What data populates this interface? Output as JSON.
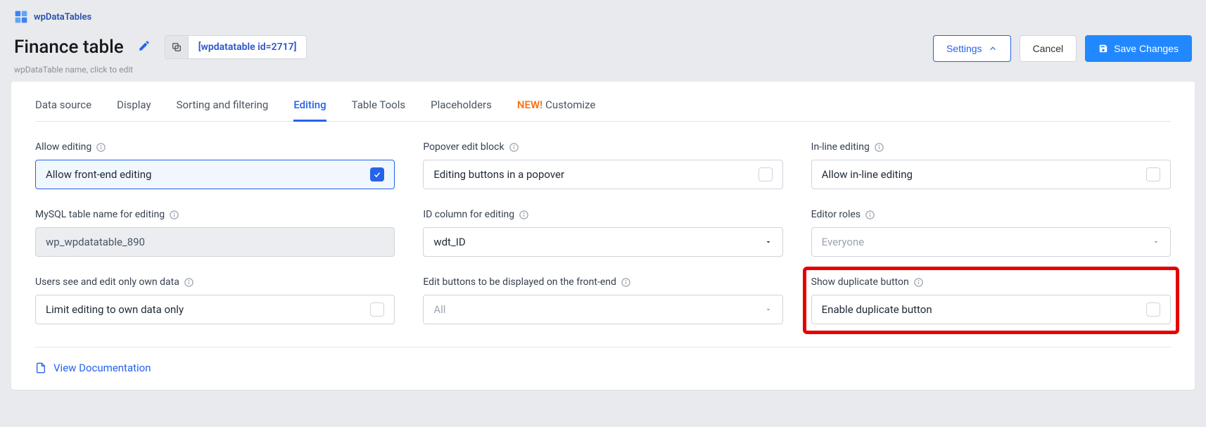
{
  "brand": {
    "name": "wpDataTables"
  },
  "header": {
    "title": "Finance table",
    "subtitle": "wpDataTable name, click to edit",
    "shortcode": "[wpdatatable id=2717]"
  },
  "actions": {
    "settings": "Settings",
    "cancel": "Cancel",
    "save": "Save Changes"
  },
  "tabs": {
    "data_source": "Data source",
    "display": "Display",
    "sorting": "Sorting and filtering",
    "editing": "Editing",
    "table_tools": "Table Tools",
    "placeholders": "Placeholders",
    "customize_new": "NEW!",
    "customize": "Customize"
  },
  "fields": {
    "allow_editing": {
      "label": "Allow editing",
      "text": "Allow front-end editing"
    },
    "popover": {
      "label": "Popover edit block",
      "text": "Editing buttons in a popover"
    },
    "inline": {
      "label": "In-line editing",
      "text": "Allow in-line editing"
    },
    "mysql": {
      "label": "MySQL table name for editing",
      "value": "wp_wpdatatable_890"
    },
    "id_col": {
      "label": "ID column for editing",
      "value": "wdt_ID"
    },
    "editor_roles": {
      "label": "Editor roles",
      "placeholder": "Everyone"
    },
    "own_data": {
      "label": "Users see and edit only own data",
      "text": "Limit editing to own data only"
    },
    "edit_buttons": {
      "label": "Edit buttons to be displayed on the front-end",
      "placeholder": "All"
    },
    "duplicate": {
      "label": "Show duplicate button",
      "text": "Enable duplicate button"
    }
  },
  "footer": {
    "doc_link": "View Documentation"
  }
}
